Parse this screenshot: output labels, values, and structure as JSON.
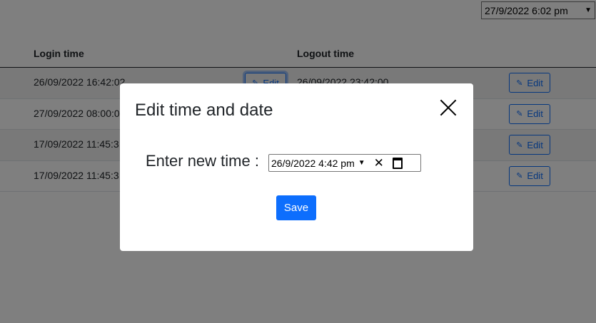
{
  "top_datetime": {
    "value": "27/9/2022  6:02  pm"
  },
  "table": {
    "headers": {
      "login": "Login time",
      "logout": "Logout time"
    },
    "rows": [
      {
        "login": "26/09/2022 16:42:02",
        "logout": "26/09/2022 23:42:00"
      },
      {
        "login": "27/09/2022 08:00:0",
        "logout": ""
      },
      {
        "login": "17/09/2022 11:45:3",
        "logout": ""
      },
      {
        "login": "17/09/2022 11:45:3",
        "logout": ""
      }
    ],
    "edit_label": "Edit"
  },
  "modal": {
    "title": "Edit time and date",
    "field_label": "Enter new time :",
    "datetime_value": "26/9/2022  4:42  pm",
    "save_label": "Save"
  },
  "icons": {
    "pencil": "pencil-icon",
    "close": "close-icon",
    "clear": "clear-icon",
    "calendar": "calendar-icon",
    "dropdown": "chevron-down-icon"
  },
  "colors": {
    "primary": "#0d6efd",
    "backdrop": "rgba(0,0,0,0.5)"
  }
}
